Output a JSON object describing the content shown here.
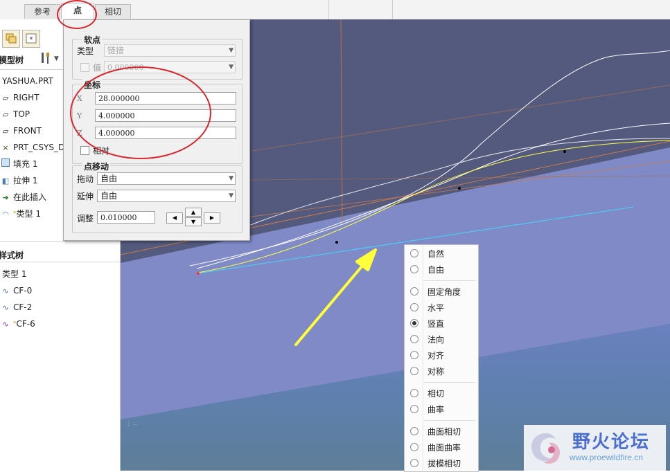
{
  "tabs": [
    {
      "label": "参考",
      "active": false
    },
    {
      "label": "点",
      "active": true
    },
    {
      "label": "相切",
      "active": false
    }
  ],
  "left_panel": {
    "model_tree_title": "模型树",
    "model_tree_items": [
      {
        "label": "YASHUA.PRT",
        "icon": "part-icon"
      },
      {
        "label": "RIGHT",
        "icon": "datum-plane-icon"
      },
      {
        "label": "TOP",
        "icon": "datum-plane-icon"
      },
      {
        "label": "FRONT",
        "icon": "datum-plane-icon"
      },
      {
        "label": "PRT_CSYS_D",
        "icon": "csys-icon"
      },
      {
        "label": "填充 1",
        "icon": "fill-icon"
      },
      {
        "label": "拉伸 1",
        "icon": "extrude-icon"
      },
      {
        "label": "在此插入",
        "icon": "insert-arrow-icon"
      },
      {
        "label": "类型 1",
        "icon": "style-icon"
      }
    ],
    "style_tree_title": "样式树",
    "style_tree_items": [
      {
        "label": "类型 1"
      },
      {
        "label": "CF-0"
      },
      {
        "label": "CF-2"
      },
      {
        "label": "CF-6"
      }
    ]
  },
  "dialog": {
    "soft_point": {
      "title": "软点",
      "type_label": "类型",
      "type_value": "链接",
      "value_label": "值",
      "value_value": "0.000000"
    },
    "coords": {
      "title": "坐标",
      "x_label": "X",
      "x_value": "28.000000",
      "y_label": "Y",
      "y_value": "4.000000",
      "z_label": "Z",
      "z_value": "4.000000",
      "relative_label": "相对"
    },
    "move": {
      "title": "点移动",
      "drag_label": "拖动",
      "drag_value": "自由",
      "extend_label": "延伸",
      "extend_value": "自由",
      "adjust_label": "调整",
      "adjust_value": "0.010000"
    }
  },
  "popup_menu": {
    "items": [
      {
        "label": "自然",
        "selected": false
      },
      {
        "label": "自由",
        "selected": false
      },
      {
        "label": "固定角度",
        "selected": false
      },
      {
        "label": "水平",
        "selected": false
      },
      {
        "label": "竖直",
        "selected": true
      },
      {
        "label": "法向",
        "selected": false
      },
      {
        "label": "对齐",
        "selected": false
      },
      {
        "label": "对称",
        "selected": false
      },
      {
        "label": "相切",
        "selected": false
      },
      {
        "label": "曲率",
        "selected": false
      },
      {
        "label": "曲面相切",
        "selected": false
      },
      {
        "label": "曲面曲率",
        "selected": false
      },
      {
        "label": "拔模相切",
        "selected": false
      }
    ]
  },
  "watermark": {
    "title": "野火论坛",
    "url": "www.proewildfire.cn"
  },
  "colors": {
    "annotation_red": "#d9262c",
    "arrow_yellow": "#ffff3a",
    "viewport_dark": "#535a7e",
    "plane_light": "#7f8ac7"
  }
}
